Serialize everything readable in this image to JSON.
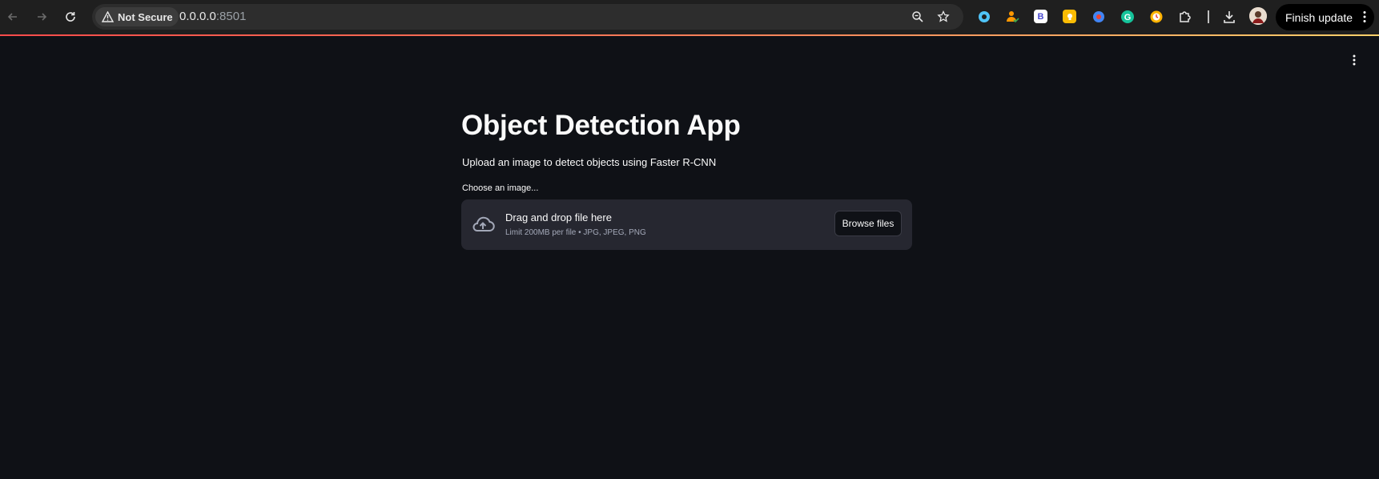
{
  "browser": {
    "security_label": "Not Secure",
    "url_host": "0.0.0.0",
    "url_port": ":8501",
    "finish_update_label": "Finish update",
    "extensions": [
      {
        "name": "chat-extension-icon",
        "color": "#4fc3f7"
      },
      {
        "name": "person-extension-icon",
        "color": "#ff9800"
      },
      {
        "name": "b-extension-icon",
        "color": "#ffffff",
        "glyph": "B"
      },
      {
        "name": "sticky-note-extension-icon",
        "color": "#fbbc04"
      },
      {
        "name": "rocket-extension-icon",
        "color": "#4285f4"
      },
      {
        "name": "grammarly-icon",
        "color": "#15c39a",
        "glyph": "G"
      },
      {
        "name": "clock-extension-icon",
        "color": "#ffb300"
      }
    ]
  },
  "app": {
    "title": "Object Detection App",
    "subtitle": "Upload an image to detect objects using Faster R-CNN",
    "uploader": {
      "label": "Choose an image...",
      "drop_text": "Drag and drop file here",
      "limit_text": "Limit 200MB per file • JPG, JPEG, PNG",
      "browse_label": "Browse files"
    }
  }
}
